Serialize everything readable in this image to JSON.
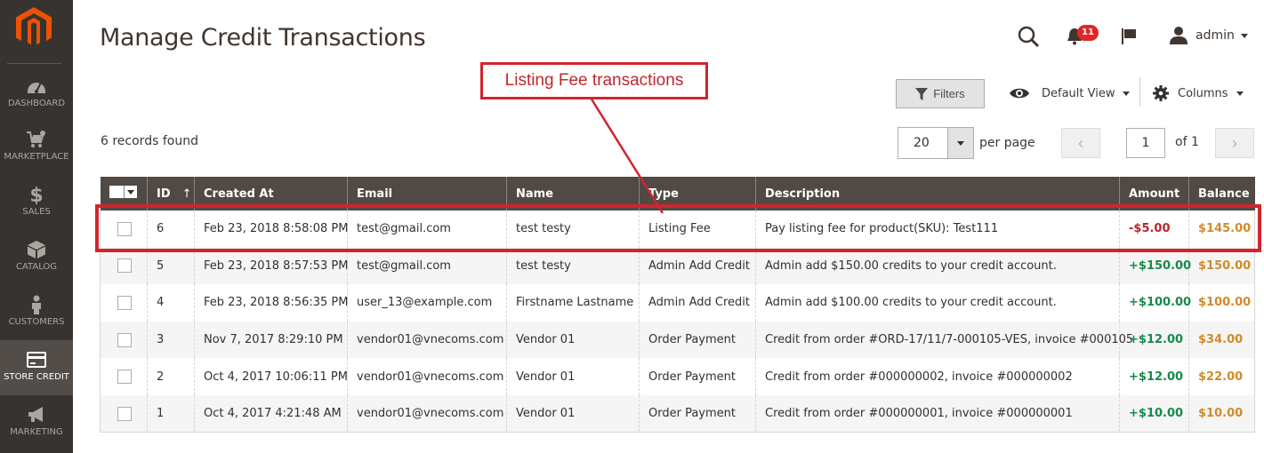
{
  "sidebar": {
    "logo": "magento-logo-icon",
    "items": [
      {
        "label": "DASHBOARD",
        "icon": "dashboard-gauge-icon",
        "active": false
      },
      {
        "label": "MARKETPLACE",
        "icon": "cart-gear-icon",
        "active": false
      },
      {
        "label": "SALES",
        "icon": "dollar-icon",
        "active": false
      },
      {
        "label": "CATALOG",
        "icon": "box-icon",
        "active": false
      },
      {
        "label": "CUSTOMERS",
        "icon": "person-icon",
        "active": false
      },
      {
        "label": "STORE CREDIT",
        "icon": "credit-card-icon",
        "active": true
      },
      {
        "label": "MARKETING",
        "icon": "megaphone-icon",
        "active": false
      }
    ]
  },
  "header": {
    "title": "Manage Credit Transactions",
    "notifications_count": "11",
    "user_name": "admin"
  },
  "toolbar": {
    "filters_label": "Filters",
    "view_label": "Default View",
    "columns_label": "Columns",
    "records_found": "6 records found",
    "per_page_value": "20",
    "per_page_label": "per page",
    "current_page": "1",
    "page_of": "of 1"
  },
  "annotation": {
    "callout_text": "Listing Fee transactions",
    "color": "#d0252c"
  },
  "grid": {
    "columns": [
      "ID",
      "Created At",
      "Email",
      "Name",
      "Type",
      "Description",
      "Amount",
      "Balance"
    ],
    "sort_indicator": "↑",
    "rows": [
      {
        "id": "6",
        "created_at": "Feb 23, 2018 8:58:08 PM",
        "email": "test@gmail.com",
        "name": "test testy",
        "type": "Listing Fee",
        "description": "Pay listing fee for product(SKU): Test111",
        "amount": "-$5.00",
        "amount_sign": "negative",
        "balance": "$145.00"
      },
      {
        "id": "5",
        "created_at": "Feb 23, 2018 8:57:53 PM",
        "email": "test@gmail.com",
        "name": "test testy",
        "type": "Admin Add Credit",
        "description": "Admin add $150.00 credits to your credit account.",
        "amount": "+$150.00",
        "amount_sign": "positive",
        "balance": "$150.00"
      },
      {
        "id": "4",
        "created_at": "Feb 23, 2018 8:56:35 PM",
        "email": "user_13@example.com",
        "name": "Firstname Lastname",
        "type": "Admin Add Credit",
        "description": "Admin add $100.00 credits to your credit account.",
        "amount": "+$100.00",
        "amount_sign": "positive",
        "balance": "$100.00"
      },
      {
        "id": "3",
        "created_at": "Nov 7, 2017 8:29:10 PM",
        "email": "vendor01@vnecoms.com",
        "name": "Vendor 01",
        "type": "Order Payment",
        "description": "Credit from order #ORD-17/11/7-000105-VES, invoice #000105",
        "amount": "+$12.00",
        "amount_sign": "positive",
        "balance": "$34.00"
      },
      {
        "id": "2",
        "created_at": "Oct 4, 2017 10:06:11 PM",
        "email": "vendor01@vnecoms.com",
        "name": "Vendor 01",
        "type": "Order Payment",
        "description": "Credit from order #000000002, invoice #000000002",
        "amount": "+$12.00",
        "amount_sign": "positive",
        "balance": "$22.00"
      },
      {
        "id": "1",
        "created_at": "Oct 4, 2017 4:21:48 AM",
        "email": "vendor01@vnecoms.com",
        "name": "Vendor 01",
        "type": "Order Payment",
        "description": "Credit from order #000000001, invoice #000000001",
        "amount": "+$10.00",
        "amount_sign": "positive",
        "balance": "$10.00"
      }
    ]
  },
  "colors": {
    "sidebar_bg": "#373330",
    "header_row_bg": "#514943",
    "amount_negative": "#b3262b",
    "amount_positive": "#168a4a",
    "balance": "#d18b2b",
    "brand_orange": "#eb5202"
  }
}
